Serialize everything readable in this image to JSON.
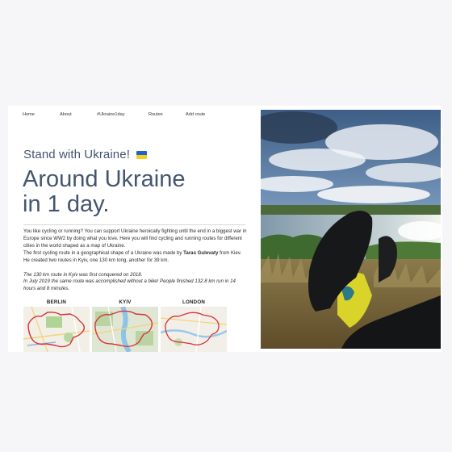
{
  "nav": {
    "items": [
      "Home",
      "About",
      "#Ukraine1day",
      "Routes",
      "Add route"
    ]
  },
  "hero": {
    "subtitle": "Stand with Ukraine!",
    "title_line1": "Around Ukraine",
    "title_line2": "in 1 day."
  },
  "body": {
    "p1": "You like cycling or running? You can support Ukraine heroically fighting until the end in a biggest war in Europe since WW2 by doing what you love. Here you will find cycling and running routes for different cities in the world shaped as a map of Ukraine.",
    "p2_start": "The first cycling route in a geographical shape of a Ukraine was made by ",
    "p2_name": "Taras Gulevaty",
    "p2_end": " from Kiev. He created two routes in Kyiv, one 130 km long, another for 39 km.",
    "p3": "The 130 km route in Kyiv was first conquered on 2018.",
    "p4": "In July 2019 the same route was accomplished without a bike! People finished 132.8 km run in 14 hours and 8 minutes."
  },
  "maps": [
    {
      "label": "BERLIN"
    },
    {
      "label": "KYIV"
    },
    {
      "label": "LONDON"
    }
  ],
  "colors": {
    "heading": "#44556f",
    "flag_blue": "#1f62c9",
    "flag_yellow": "#f6cf1b",
    "route_red": "#d9333b"
  },
  "photo": {
    "icon": "cyclist-legs-photo"
  }
}
